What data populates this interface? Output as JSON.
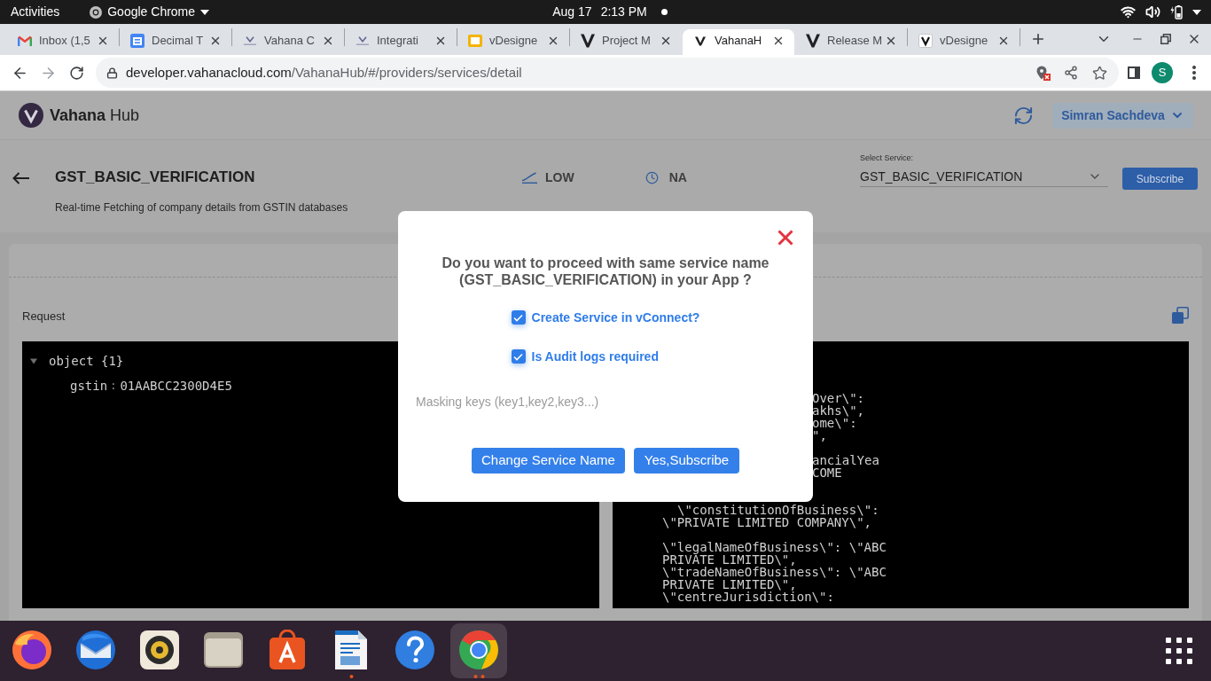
{
  "top_bar": {
    "activities": "Activities",
    "app_name": "Google Chrome",
    "date": "Aug 17",
    "time": "2:13 PM"
  },
  "browser": {
    "tabs": [
      {
        "title": "Inbox (1,5",
        "kind": "gmail",
        "selected": false
      },
      {
        "title": "Decimal T",
        "kind": "calendar",
        "selected": false
      },
      {
        "title": "Vahana C",
        "kind": "mark",
        "selected": false
      },
      {
        "title": "Integrati",
        "kind": "mark",
        "selected": false
      },
      {
        "title": "vDesigne",
        "kind": "slides",
        "selected": false
      },
      {
        "title": "Project M",
        "kind": "logo",
        "selected": false
      },
      {
        "title": "VahanaH",
        "kind": "logo-small",
        "selected": true
      },
      {
        "title": "Release M",
        "kind": "logo",
        "selected": false
      },
      {
        "title": "vDesigne",
        "kind": "logo-boxed",
        "selected": false
      }
    ],
    "address": {
      "host": "developer.vahanacloud.com",
      "path": "/VahanaHub/#/providers/services/detail"
    },
    "profile_initial": "S"
  },
  "header": {
    "brand": "**Vahana** Hub",
    "user": "Simran Sachdeva"
  },
  "service": {
    "name": "GST_BASIC_VERIFICATION",
    "description": "Real-time Fetching of company details from GSTIN databases",
    "load": "LOW",
    "time": "NA",
    "select": {
      "label": "Select Service:",
      "value": "GST_BASIC_VERIFICATION"
    },
    "subscribe": "Subscribe"
  },
  "request": {
    "title": "Request",
    "tree": {
      "label": "object {1}",
      "expanded": true,
      "children": [
        {
          "key": "gstin",
          "separator": ":",
          "value": "01AABCC2300D4E5"
        }
      ]
    }
  },
  "response": {
    "blocks": [
      {
        "kind": "beside_dialog",
        "lines": [
          "Over\\\":",
          "akhs\\\",",
          "ome\\\":",
          "\","
        ]
      },
      {
        "kind": "beside_dialog",
        "lines": [
          "ancialYea",
          "COME"
        ]
      },
      {
        "kind": "below_dialog",
        "lines": [
          "\\\"constitutionOfBusiness\\\":",
          "\\\"PRIVATE LIMITED COMPANY\\\","
        ]
      },
      {
        "kind": "below_dialog",
        "lines": [
          "\\\"legalNameOfBusiness\\\": \\\"ABC",
          "PRIVATE LIMITED\\\",",
          "\\\"tradeNameOfBusiness\\\": \\\"ABC",
          "PRIVATE LIMITED\\\",",
          "\\\"centreJurisdiction\\\":"
        ]
      }
    ]
  },
  "dialog": {
    "question": "Do you want to proceed with same service name (GST_BASIC_VERIFICATION) in your App ?",
    "options": [
      {
        "label": "Create Service in vConnect?",
        "checked": true
      },
      {
        "label": "Is Audit logs required",
        "checked": true
      }
    ],
    "masking_keys": {
      "placeholder": "Masking keys (key1,key2,key3...)"
    },
    "buttons": [
      {
        "label": "Change Service Name"
      },
      {
        "label": "Yes,Subscribe"
      }
    ]
  },
  "dock": {
    "apps": [
      {
        "kind": "firefox",
        "running": false,
        "multiple_windows": false,
        "selected": false
      },
      {
        "kind": "thunderbird",
        "running": false,
        "multiple_windows": false,
        "selected": false
      },
      {
        "kind": "rhythmbox",
        "running": false,
        "multiple_windows": false,
        "selected": false
      },
      {
        "kind": "files",
        "running": false,
        "multiple_windows": false,
        "selected": false
      },
      {
        "kind": "software",
        "running": false,
        "multiple_windows": false,
        "selected": false
      },
      {
        "kind": "writer",
        "running": true,
        "multiple_windows": false,
        "selected": false
      },
      {
        "kind": "help",
        "running": false,
        "multiple_windows": false,
        "selected": false
      },
      {
        "kind": "chrome",
        "running": true,
        "multiple_windows": true,
        "selected": true
      }
    ]
  }
}
